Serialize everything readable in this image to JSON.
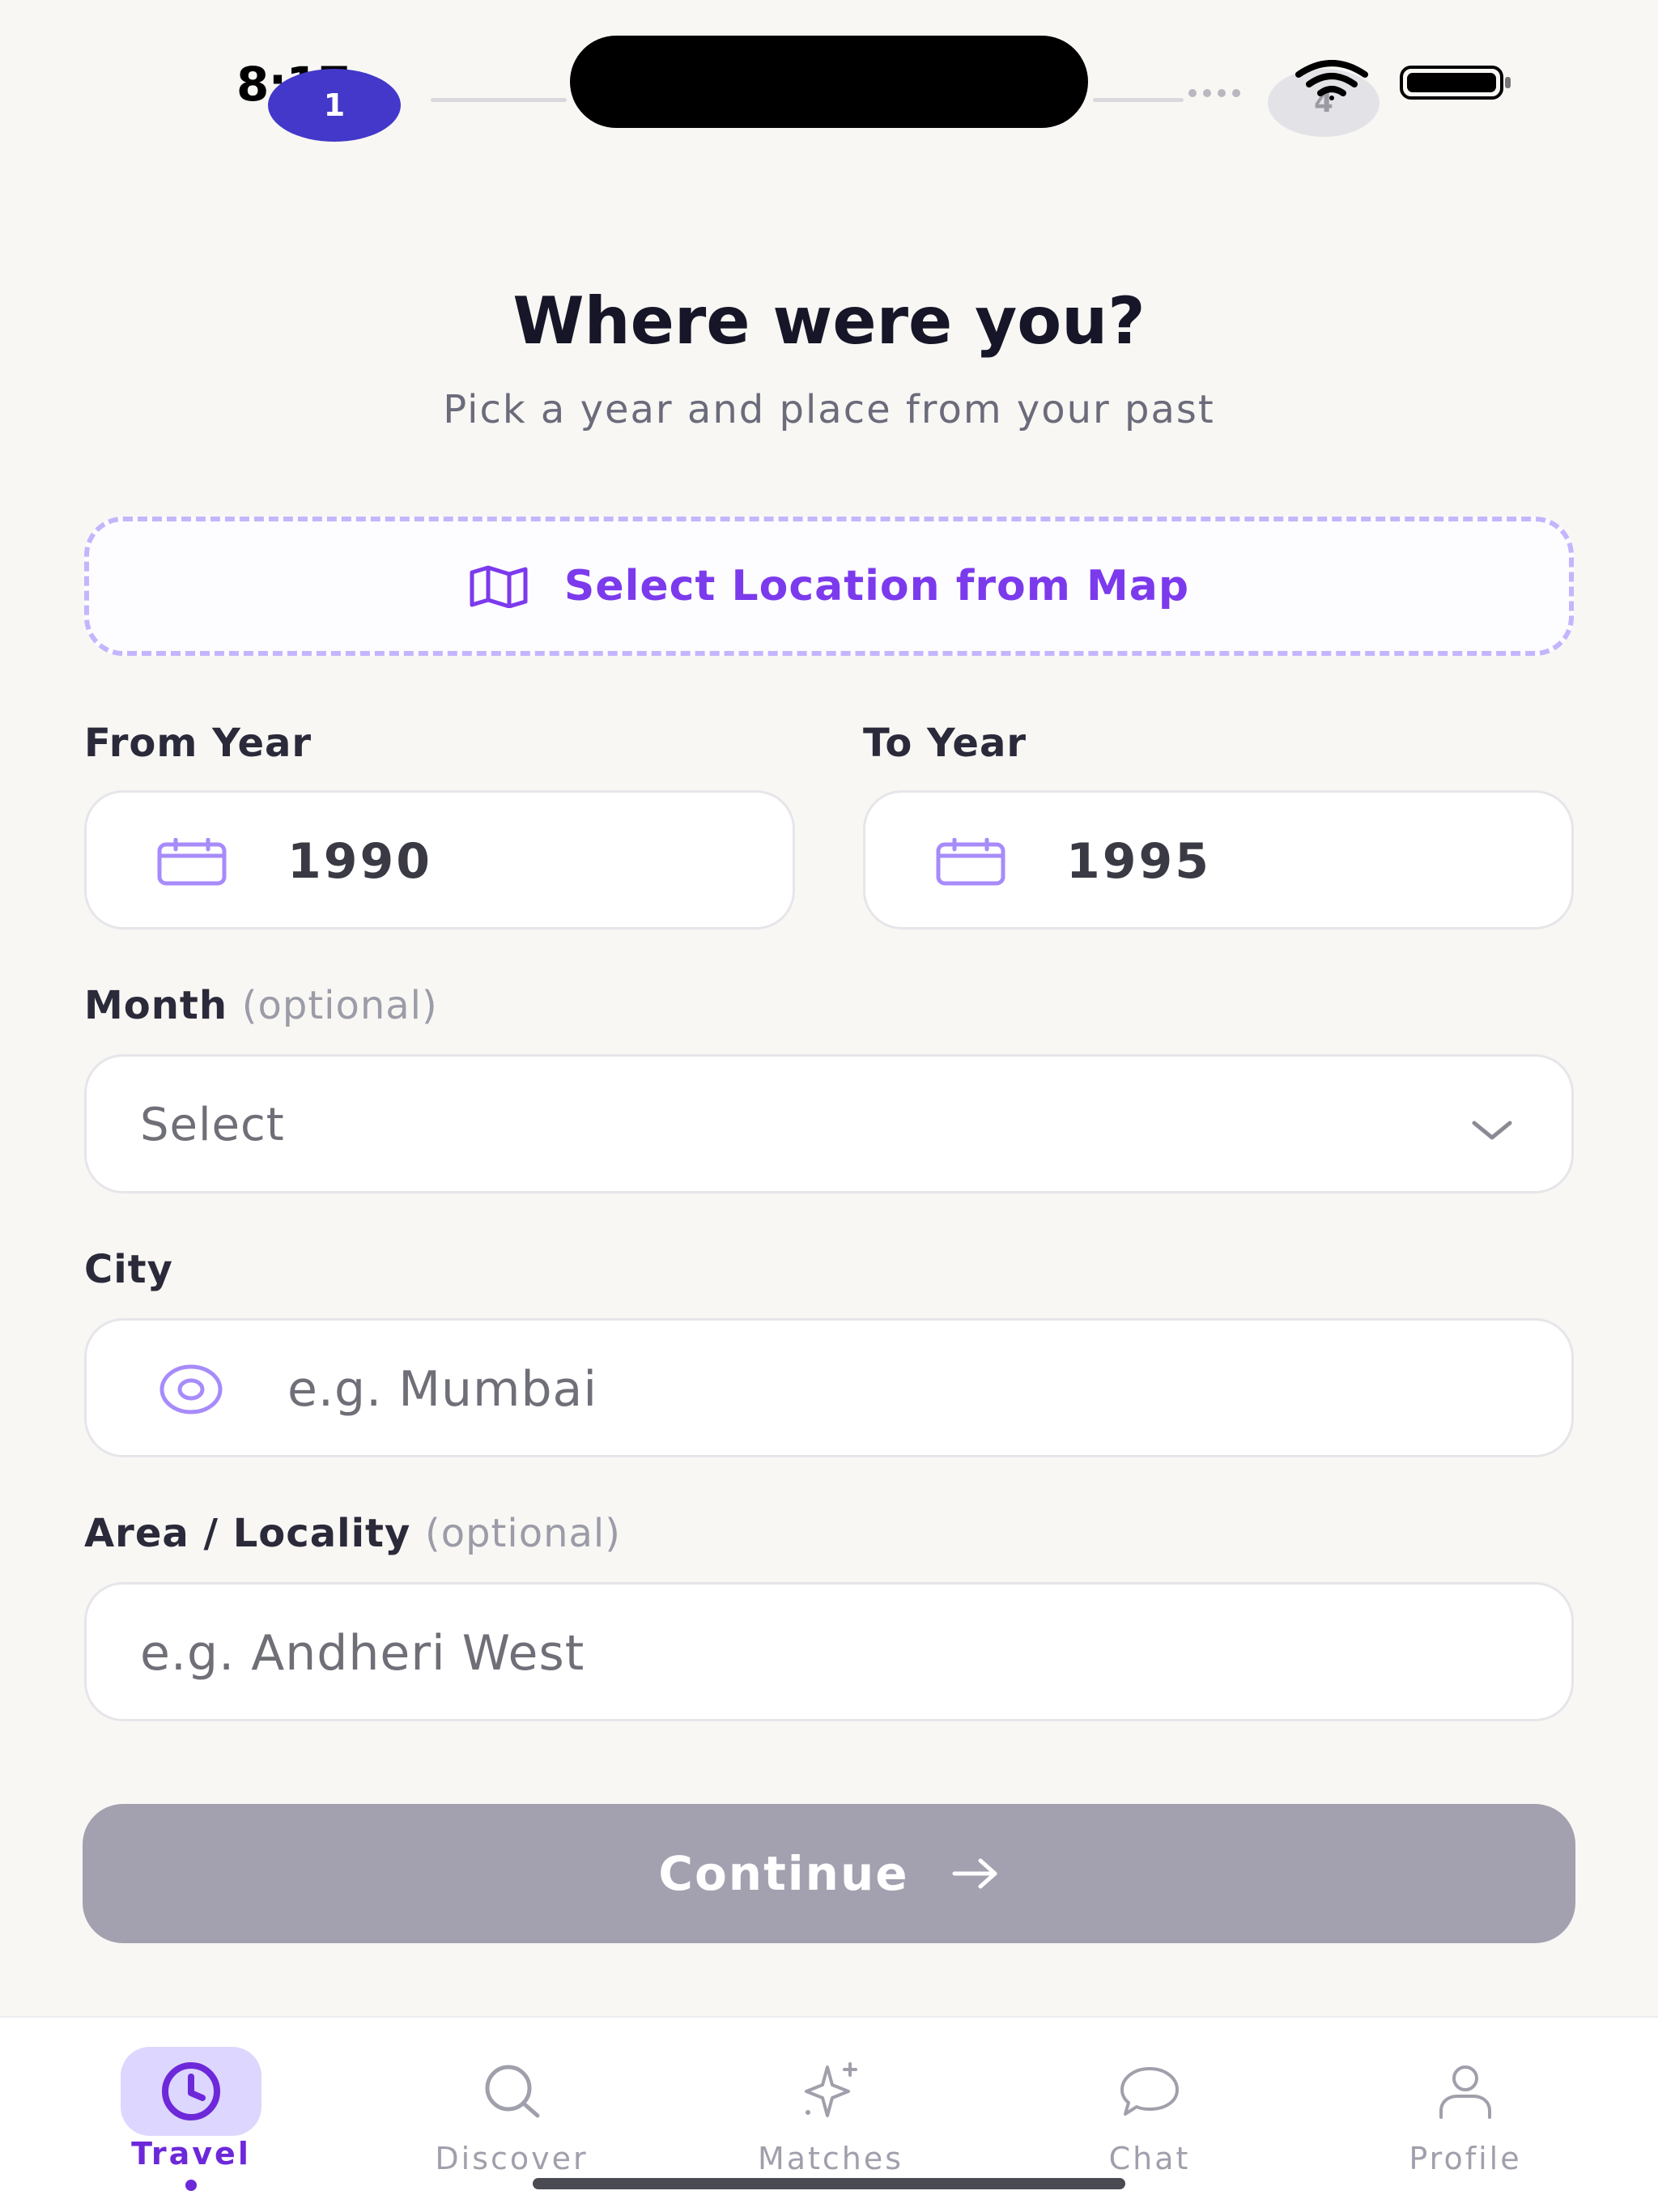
{
  "status_bar": {
    "time": "8:17",
    "current_step": "1",
    "last_step": "4"
  },
  "header": {
    "title": "Where were you?",
    "subtitle": "Pick a year and place from your past"
  },
  "map_button": {
    "label": "Select Location from Map",
    "icon": "map-icon"
  },
  "from_year": {
    "label": "From Year",
    "value": "1990",
    "icon": "calendar-icon"
  },
  "to_year": {
    "label": "To Year",
    "value": "1995",
    "icon": "calendar-icon"
  },
  "month": {
    "label": "Month",
    "optional_note": "(optional)",
    "value": "Select",
    "icon": "chevron-down-icon"
  },
  "city": {
    "label": "City",
    "placeholder": "e.g. Mumbai",
    "icon": "location-pin-icon"
  },
  "area": {
    "label": "Area / Locality",
    "optional_note": "(optional)",
    "placeholder": "e.g. Andheri West"
  },
  "continue_button": {
    "label": "Continue",
    "icon": "arrow-right-icon",
    "color": "#a3a1b0"
  },
  "tab_bar": {
    "tabs": [
      {
        "label": "Travel",
        "icon": "clock-icon",
        "active": true
      },
      {
        "label": "Discover",
        "icon": "search-icon",
        "active": false
      },
      {
        "label": "Matches",
        "icon": "sparkles-icon",
        "active": false
      },
      {
        "label": "Chat",
        "icon": "chat-bubble-icon",
        "active": false
      },
      {
        "label": "Profile",
        "icon": "user-icon",
        "active": false
      }
    ]
  },
  "colors": {
    "accent": "#7c3aed",
    "accent_light": "#ddd6fe",
    "background": "#f8f7f4"
  }
}
